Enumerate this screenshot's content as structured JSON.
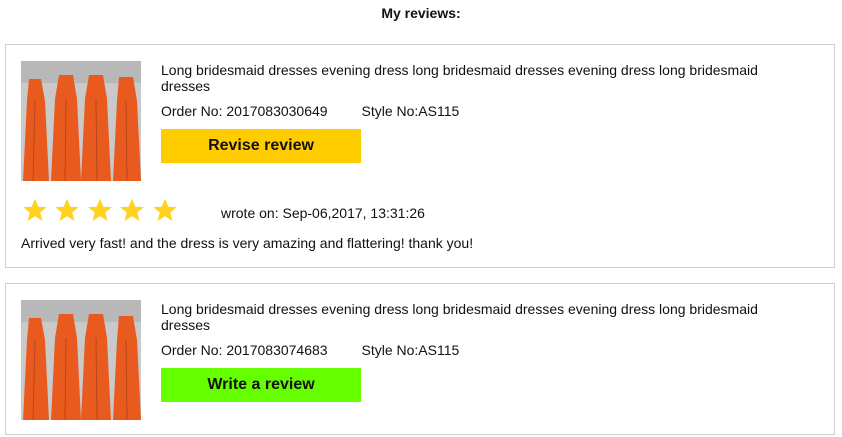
{
  "page_title": "My reviews:",
  "colors": {
    "revise_button": "#ffcc00",
    "write_button": "#66ff00",
    "star": "#ffd21f",
    "card_border": "#cfcfcf"
  },
  "reviews": [
    {
      "product_title": "Long bridesmaid dresses evening dress long bridesmaid dresses evening dress long bridesmaid dresses",
      "order_label": "Order No:",
      "order_no": "2017083030649",
      "style_label": "Style No:",
      "style_no": "AS115",
      "button_label": "Revise review",
      "rating": 5,
      "wrote_on": "wrote on: Sep-06,2017, 13:31:26",
      "comment": "Arrived very fast! and the dress is very amazing and flattering! thank you!"
    },
    {
      "product_title": "Long bridesmaid dresses evening dress long bridesmaid dresses evening dress long bridesmaid dresses",
      "order_label": "Order No:",
      "order_no": "2017083074683",
      "style_label": "Style No:",
      "style_no": "AS115",
      "button_label": "Write a review"
    }
  ]
}
